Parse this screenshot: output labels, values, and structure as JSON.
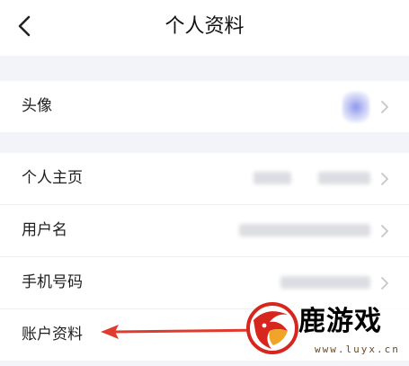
{
  "header": {
    "title": "个人资料",
    "back_icon": "chevron-left-icon"
  },
  "sections": [
    {
      "rows": [
        {
          "label": "头像",
          "value_type": "avatar"
        }
      ]
    },
    {
      "rows": [
        {
          "label": "个人主页",
          "value_type": "blurred"
        },
        {
          "label": "用户名",
          "value_type": "blurred"
        },
        {
          "label": "手机号码",
          "value_type": "blurred"
        },
        {
          "label": "账户资料",
          "value_type": "highlighted"
        }
      ]
    }
  ],
  "annotation": {
    "arrow_color": "#e03b2e",
    "points_to": "账户资料"
  },
  "watermark": {
    "name": "鹿游戏",
    "url": "www.luyx.cn",
    "logo_colors": [
      "#d7261e",
      "#f0a528"
    ]
  },
  "colors": {
    "background": "#f3f4f9",
    "card": "#ffffff",
    "arrow": "#e03b2e"
  }
}
